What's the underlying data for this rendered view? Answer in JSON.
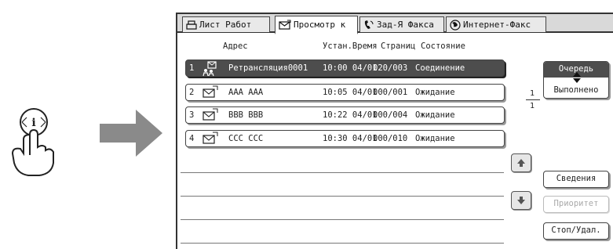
{
  "tabs": [
    {
      "label": "Лист Работ",
      "icon": "print-icon",
      "active": false
    },
    {
      "label": "Просмотр к",
      "icon": "envelope-icon",
      "active": true
    },
    {
      "label": "Зад-Я Факса",
      "icon": "fax-phone-icon",
      "active": false
    },
    {
      "label": "Интернет-Факс",
      "icon": "globe-icon",
      "active": false
    }
  ],
  "columns": {
    "address": "Адрес",
    "time": "Устан.Время",
    "pages": "Страниц",
    "status": "Состояние"
  },
  "rows": [
    {
      "num": "1",
      "icon": "relay-icon",
      "address": "Ретрансляция0001",
      "time": "10:00 04/01",
      "pages": "020/003",
      "status": "Соединение",
      "selected": true
    },
    {
      "num": "2",
      "icon": "email-icon",
      "address": "AAA AAA",
      "time": "10:05 04/01",
      "pages": "000/001",
      "status": "Ожидание",
      "selected": false
    },
    {
      "num": "3",
      "icon": "email-icon",
      "address": "BBB BBB",
      "time": "10:22 04/01",
      "pages": "000/004",
      "status": "Ожидание",
      "selected": false
    },
    {
      "num": "4",
      "icon": "email-icon",
      "address": "CCC CCC",
      "time": "10:30 04/01",
      "pages": "000/010",
      "status": "Ожидание",
      "selected": false
    }
  ],
  "pager": {
    "current": "1",
    "total": "1"
  },
  "buttons": {
    "queue_top": "Очередь",
    "queue_bottom": "Выполнено",
    "details": "Сведения",
    "priority": "Приоритет",
    "stop_delete": "Стоп/Удал."
  },
  "colors": {
    "selected_bg": "#4d4d4d",
    "tabbar_bg": "#d9d9d9",
    "arrow": "#8a8a8a"
  }
}
